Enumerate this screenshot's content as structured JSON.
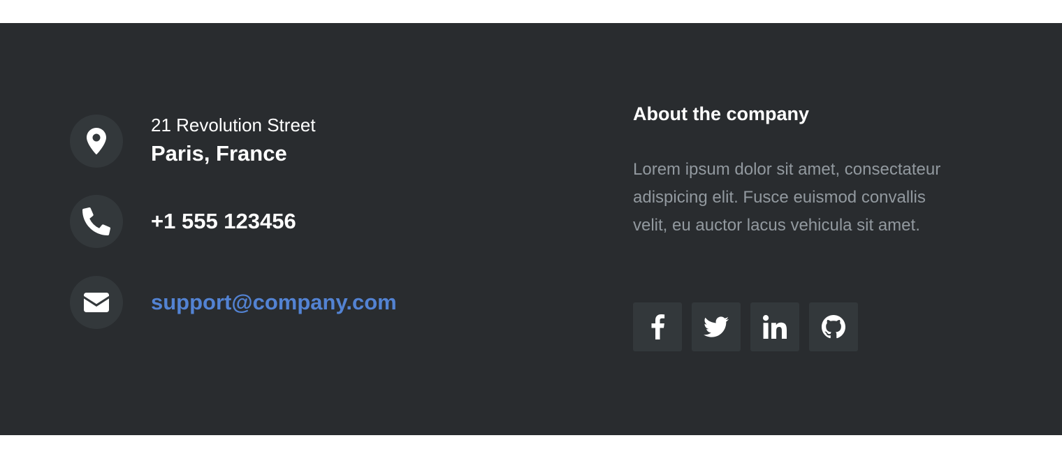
{
  "contact": {
    "address": {
      "icon": "map-marker-icon",
      "street": "21 Revolution Street",
      "city": "Paris, France"
    },
    "phone": {
      "icon": "phone-icon",
      "number": "+1 555 123456"
    },
    "email": {
      "icon": "envelope-icon",
      "address": "support@company.com"
    }
  },
  "about": {
    "title": "About the company",
    "text": "Lorem ipsum dolor sit amet, consectateur adispicing elit. Fusce euismod convallis velit, eu auctor lacus vehicula sit amet."
  },
  "social": [
    {
      "icon": "facebook-icon"
    },
    {
      "icon": "twitter-icon"
    },
    {
      "icon": "linkedin-icon"
    },
    {
      "icon": "github-icon"
    }
  ],
  "colors": {
    "footer_bg": "#292c2f",
    "icon_bg": "#33383b",
    "link": "#5383d3",
    "muted_text": "#92999f"
  }
}
